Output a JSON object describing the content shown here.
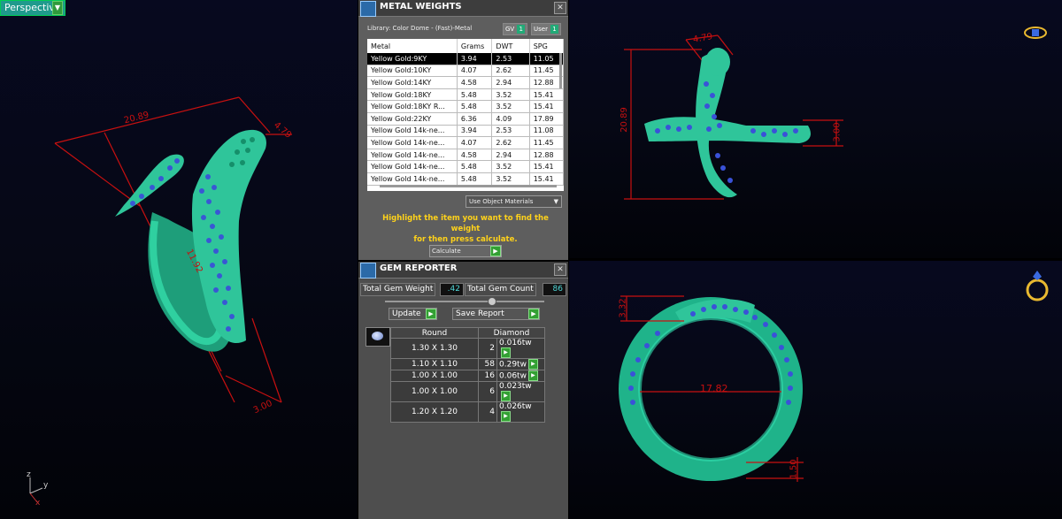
{
  "viewport_perspective": {
    "label": "Perspective",
    "dimensions": [
      "20.89",
      "4.79",
      "11.92",
      "3.00"
    ],
    "axis_labels": [
      "z",
      "y",
      "x"
    ]
  },
  "viewport_top": {
    "dimensions": [
      "4.79",
      "20.89",
      "3.00"
    ]
  },
  "viewport_front": {
    "dimensions": [
      "3.32",
      "17.82",
      "1.50"
    ]
  },
  "metal_weights": {
    "title": "METAL WEIGHTS",
    "library": "Library: Color Dome - (Fast)-Metal",
    "gv_label": "GV",
    "gv_value": "1",
    "user_label": "User",
    "user_value": "1",
    "columns": [
      "Metal",
      "Grams",
      "DWT",
      "SPG"
    ],
    "rows": [
      [
        "Yellow Gold:9KY",
        "3.94",
        "2.53",
        "11.05"
      ],
      [
        "Yellow Gold:10KY",
        "4.07",
        "2.62",
        "11.45"
      ],
      [
        "Yellow Gold:14KY",
        "4.58",
        "2.94",
        "12.88"
      ],
      [
        "Yellow Gold:18KY",
        "5.48",
        "3.52",
        "15.41"
      ],
      [
        "Yellow Gold:18KY R...",
        "5.48",
        "3.52",
        "15.41"
      ],
      [
        "Yellow Gold:22KY",
        "6.36",
        "4.09",
        "17.89"
      ],
      [
        "Yellow Gold 14k-ne...",
        "3.94",
        "2.53",
        "11.08"
      ],
      [
        "Yellow Gold 14k-ne...",
        "4.07",
        "2.62",
        "11.45"
      ],
      [
        "Yellow Gold 14k-ne...",
        "4.58",
        "2.94",
        "12.88"
      ],
      [
        "Yellow Gold 14k-ne...",
        "5.48",
        "3.52",
        "15.41"
      ],
      [
        "Yellow Gold 14k-ne...",
        "5.48",
        "3.52",
        "15.41"
      ]
    ],
    "selected_row": 0,
    "material_dropdown": "Use Object Materials",
    "hint_line1": "Highlight the item you want to find the weight",
    "hint_line2": "for then press calculate.",
    "calculate_label": "Calculate"
  },
  "gem_reporter": {
    "title": "GEM REPORTER",
    "total_weight_label": "Total Gem Weight",
    "total_weight_value": ".42",
    "total_count_label": "Total Gem Count",
    "total_count_value": "86",
    "update_label": "Update",
    "save_report_label": "Save Report",
    "columns": [
      "Round",
      "Diamond"
    ],
    "rows": [
      [
        "1.30 X 1.30",
        "2",
        "0.016tw"
      ],
      [
        "1.10 X 1.10",
        "58",
        "0.29tw"
      ],
      [
        "1.00 X 1.00",
        "16",
        "0.06tw"
      ],
      [
        "1.00 X 1.00",
        "6",
        "0.023tw"
      ],
      [
        "1.20 X 1.20",
        "4",
        "0.026tw"
      ]
    ]
  },
  "colors": {
    "dimension_red": "#c81010",
    "metal_green": "#2fc59a",
    "gem_blue": "#3a52d8",
    "hint_yellow": "#ffd21a"
  },
  "icons": [
    "cube-icon",
    "gem-icon",
    "ring-top-icon",
    "ring-front-icon",
    "axis-icon",
    "play-arrow-icon"
  ]
}
